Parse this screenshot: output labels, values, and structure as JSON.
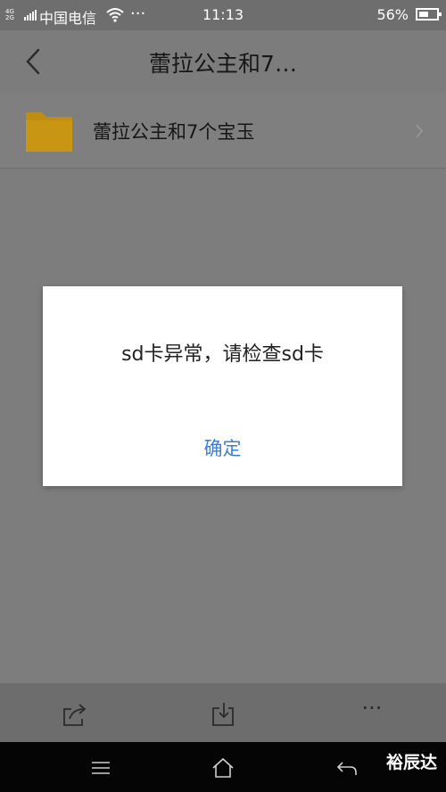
{
  "status_bar": {
    "network": "4G 2G",
    "carrier": "中国电信",
    "more": "···",
    "time": "11:13",
    "battery_percent": "56%",
    "battery_level": 0.56
  },
  "header": {
    "back_icon": "chevron-left-icon",
    "title": "蕾拉公主和7…"
  },
  "folder": {
    "icon": "folder-icon",
    "name": "蕾拉公主和7个宝玉",
    "color": "#c08d13"
  },
  "dialog": {
    "message": "sd卡异常，请检查sd卡",
    "ok_label": "确定",
    "ok_color": "#3a7fd6"
  },
  "bottom_toolbar": {
    "items": [
      "share-icon",
      "download-icon",
      "more-icon"
    ],
    "more_label": "···"
  },
  "nav_bar": {
    "items": [
      "menu-icon",
      "home-icon",
      "back-icon"
    ],
    "watermark": "裕辰达"
  }
}
